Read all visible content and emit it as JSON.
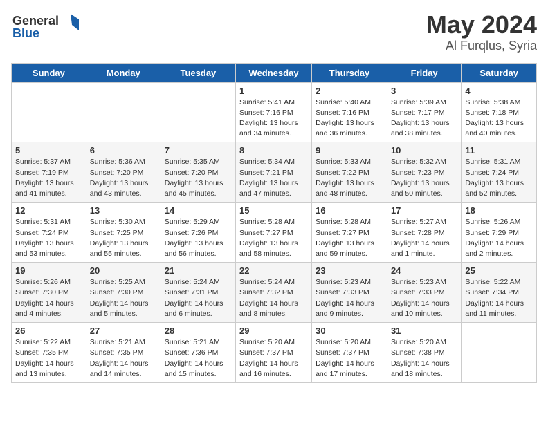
{
  "header": {
    "logo_line1": "General",
    "logo_line2": "Blue",
    "month": "May 2024",
    "location": "Al Furqlus, Syria"
  },
  "weekdays": [
    "Sunday",
    "Monday",
    "Tuesday",
    "Wednesday",
    "Thursday",
    "Friday",
    "Saturday"
  ],
  "weeks": [
    [
      {
        "day": "",
        "info": ""
      },
      {
        "day": "",
        "info": ""
      },
      {
        "day": "",
        "info": ""
      },
      {
        "day": "1",
        "info": "Sunrise: 5:41 AM\nSunset: 7:16 PM\nDaylight: 13 hours\nand 34 minutes."
      },
      {
        "day": "2",
        "info": "Sunrise: 5:40 AM\nSunset: 7:16 PM\nDaylight: 13 hours\nand 36 minutes."
      },
      {
        "day": "3",
        "info": "Sunrise: 5:39 AM\nSunset: 7:17 PM\nDaylight: 13 hours\nand 38 minutes."
      },
      {
        "day": "4",
        "info": "Sunrise: 5:38 AM\nSunset: 7:18 PM\nDaylight: 13 hours\nand 40 minutes."
      }
    ],
    [
      {
        "day": "5",
        "info": "Sunrise: 5:37 AM\nSunset: 7:19 PM\nDaylight: 13 hours\nand 41 minutes."
      },
      {
        "day": "6",
        "info": "Sunrise: 5:36 AM\nSunset: 7:20 PM\nDaylight: 13 hours\nand 43 minutes."
      },
      {
        "day": "7",
        "info": "Sunrise: 5:35 AM\nSunset: 7:20 PM\nDaylight: 13 hours\nand 45 minutes."
      },
      {
        "day": "8",
        "info": "Sunrise: 5:34 AM\nSunset: 7:21 PM\nDaylight: 13 hours\nand 47 minutes."
      },
      {
        "day": "9",
        "info": "Sunrise: 5:33 AM\nSunset: 7:22 PM\nDaylight: 13 hours\nand 48 minutes."
      },
      {
        "day": "10",
        "info": "Sunrise: 5:32 AM\nSunset: 7:23 PM\nDaylight: 13 hours\nand 50 minutes."
      },
      {
        "day": "11",
        "info": "Sunrise: 5:31 AM\nSunset: 7:24 PM\nDaylight: 13 hours\nand 52 minutes."
      }
    ],
    [
      {
        "day": "12",
        "info": "Sunrise: 5:31 AM\nSunset: 7:24 PM\nDaylight: 13 hours\nand 53 minutes."
      },
      {
        "day": "13",
        "info": "Sunrise: 5:30 AM\nSunset: 7:25 PM\nDaylight: 13 hours\nand 55 minutes."
      },
      {
        "day": "14",
        "info": "Sunrise: 5:29 AM\nSunset: 7:26 PM\nDaylight: 13 hours\nand 56 minutes."
      },
      {
        "day": "15",
        "info": "Sunrise: 5:28 AM\nSunset: 7:27 PM\nDaylight: 13 hours\nand 58 minutes."
      },
      {
        "day": "16",
        "info": "Sunrise: 5:28 AM\nSunset: 7:27 PM\nDaylight: 13 hours\nand 59 minutes."
      },
      {
        "day": "17",
        "info": "Sunrise: 5:27 AM\nSunset: 7:28 PM\nDaylight: 14 hours\nand 1 minute."
      },
      {
        "day": "18",
        "info": "Sunrise: 5:26 AM\nSunset: 7:29 PM\nDaylight: 14 hours\nand 2 minutes."
      }
    ],
    [
      {
        "day": "19",
        "info": "Sunrise: 5:26 AM\nSunset: 7:30 PM\nDaylight: 14 hours\nand 4 minutes."
      },
      {
        "day": "20",
        "info": "Sunrise: 5:25 AM\nSunset: 7:30 PM\nDaylight: 14 hours\nand 5 minutes."
      },
      {
        "day": "21",
        "info": "Sunrise: 5:24 AM\nSunset: 7:31 PM\nDaylight: 14 hours\nand 6 minutes."
      },
      {
        "day": "22",
        "info": "Sunrise: 5:24 AM\nSunset: 7:32 PM\nDaylight: 14 hours\nand 8 minutes."
      },
      {
        "day": "23",
        "info": "Sunrise: 5:23 AM\nSunset: 7:33 PM\nDaylight: 14 hours\nand 9 minutes."
      },
      {
        "day": "24",
        "info": "Sunrise: 5:23 AM\nSunset: 7:33 PM\nDaylight: 14 hours\nand 10 minutes."
      },
      {
        "day": "25",
        "info": "Sunrise: 5:22 AM\nSunset: 7:34 PM\nDaylight: 14 hours\nand 11 minutes."
      }
    ],
    [
      {
        "day": "26",
        "info": "Sunrise: 5:22 AM\nSunset: 7:35 PM\nDaylight: 14 hours\nand 13 minutes."
      },
      {
        "day": "27",
        "info": "Sunrise: 5:21 AM\nSunset: 7:35 PM\nDaylight: 14 hours\nand 14 minutes."
      },
      {
        "day": "28",
        "info": "Sunrise: 5:21 AM\nSunset: 7:36 PM\nDaylight: 14 hours\nand 15 minutes."
      },
      {
        "day": "29",
        "info": "Sunrise: 5:20 AM\nSunset: 7:37 PM\nDaylight: 14 hours\nand 16 minutes."
      },
      {
        "day": "30",
        "info": "Sunrise: 5:20 AM\nSunset: 7:37 PM\nDaylight: 14 hours\nand 17 minutes."
      },
      {
        "day": "31",
        "info": "Sunrise: 5:20 AM\nSunset: 7:38 PM\nDaylight: 14 hours\nand 18 minutes."
      },
      {
        "day": "",
        "info": ""
      }
    ]
  ]
}
